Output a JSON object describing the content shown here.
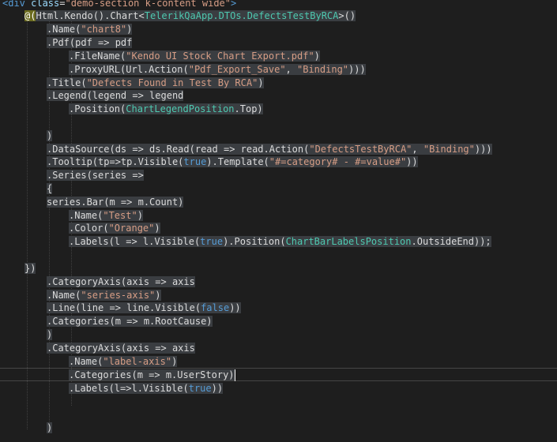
{
  "editor": {
    "lines": [
      {
        "indent": 0,
        "segments": [
          {
            "c": "t-tag",
            "t": "<div "
          },
          {
            "c": "t-attr",
            "t": "class"
          },
          {
            "c": "t-plain",
            "t": "="
          },
          {
            "c": "t-str",
            "t": "\"demo-section k-content wide\""
          },
          {
            "c": "t-tag",
            "t": ">"
          }
        ]
      },
      {
        "indent": 1,
        "segments": [
          {
            "c": "t-razor",
            "t": "@("
          },
          {
            "c": "t-plain",
            "t": "Html.Kendo().Chart<"
          },
          {
            "c": "t-type",
            "t": "TelerikQaApp.DTOs.DefectsTestByRCA"
          },
          {
            "c": "t-plain",
            "t": ">()"
          }
        ]
      },
      {
        "indent": 2,
        "segments": [
          {
            "c": "t-plain",
            "t": ".Name("
          },
          {
            "c": "t-str",
            "t": "\"chart8\""
          },
          {
            "c": "t-plain",
            "t": ")"
          }
        ]
      },
      {
        "indent": 2,
        "segments": [
          {
            "c": "t-plain",
            "t": ".Pdf(pdf => pdf"
          }
        ]
      },
      {
        "indent": 3,
        "segments": [
          {
            "c": "t-plain",
            "t": ".FileName("
          },
          {
            "c": "t-str",
            "t": "\"Kendo UI Stock Chart Export.pdf\""
          },
          {
            "c": "t-plain",
            "t": ")"
          }
        ]
      },
      {
        "indent": 3,
        "segments": [
          {
            "c": "t-plain",
            "t": ".ProxyURL(Url.Action("
          },
          {
            "c": "t-str",
            "t": "\"Pdf_Export_Save\""
          },
          {
            "c": "t-plain",
            "t": ", "
          },
          {
            "c": "t-str",
            "t": "\"Binding\""
          },
          {
            "c": "t-plain",
            "t": ")))"
          }
        ]
      },
      {
        "indent": 2,
        "segments": [
          {
            "c": "t-plain",
            "t": ".Title("
          },
          {
            "c": "t-str",
            "t": "\"Defects Found in Test By RCA\""
          },
          {
            "c": "t-plain",
            "t": ")"
          }
        ]
      },
      {
        "indent": 2,
        "segments": [
          {
            "c": "t-plain",
            "t": ".Legend(legend => legend"
          }
        ]
      },
      {
        "indent": 3,
        "segments": [
          {
            "c": "t-plain",
            "t": ".Position("
          },
          {
            "c": "t-type",
            "t": "ChartLegendPosition"
          },
          {
            "c": "t-plain",
            "t": ".Top)"
          }
        ]
      },
      {
        "indent": 0,
        "segments": []
      },
      {
        "indent": 2,
        "segments": [
          {
            "c": "t-plain",
            "t": ")"
          }
        ]
      },
      {
        "indent": 2,
        "segments": [
          {
            "c": "t-plain",
            "t": ".DataSource(ds => ds.Read(read => read.Action("
          },
          {
            "c": "t-str",
            "t": "\"DefectsTestByRCA\""
          },
          {
            "c": "t-plain",
            "t": ", "
          },
          {
            "c": "t-str",
            "t": "\"Binding\""
          },
          {
            "c": "t-plain",
            "t": ")))"
          }
        ]
      },
      {
        "indent": 2,
        "segments": [
          {
            "c": "t-plain",
            "t": ".Tooltip(tp=>tp.Visible("
          },
          {
            "c": "t-kw",
            "t": "true"
          },
          {
            "c": "t-plain",
            "t": ").Template("
          },
          {
            "c": "t-str",
            "t": "\"#=category# - #=value#\""
          },
          {
            "c": "t-plain",
            "t": "))"
          }
        ]
      },
      {
        "indent": 2,
        "segments": [
          {
            "c": "t-plain",
            "t": ".Series(series =>"
          }
        ]
      },
      {
        "indent": 2,
        "segments": [
          {
            "c": "t-plain",
            "t": "{"
          }
        ]
      },
      {
        "indent": 2,
        "segments": [
          {
            "c": "t-plain",
            "t": "series.Bar(m => m.Count)"
          }
        ]
      },
      {
        "indent": 3,
        "segments": [
          {
            "c": "t-plain",
            "t": ".Name("
          },
          {
            "c": "t-str",
            "t": "\"Test\""
          },
          {
            "c": "t-plain",
            "t": ")"
          }
        ]
      },
      {
        "indent": 3,
        "segments": [
          {
            "c": "t-plain",
            "t": ".Color("
          },
          {
            "c": "t-str",
            "t": "\"Orange\""
          },
          {
            "c": "t-plain",
            "t": ")"
          }
        ]
      },
      {
        "indent": 3,
        "segments": [
          {
            "c": "t-plain",
            "t": ".Labels(l => l.Visible("
          },
          {
            "c": "t-kw",
            "t": "true"
          },
          {
            "c": "t-plain",
            "t": ").Position("
          },
          {
            "c": "t-type",
            "t": "ChartBarLabelsPosition"
          },
          {
            "c": "t-plain",
            "t": ".OutsideEnd));"
          }
        ]
      },
      {
        "indent": 0,
        "segments": []
      },
      {
        "indent": 1,
        "segments": [
          {
            "c": "t-plain",
            "t": "})"
          }
        ]
      },
      {
        "indent": 2,
        "segments": [
          {
            "c": "t-plain",
            "t": ".CategoryAxis(axis => axis"
          }
        ]
      },
      {
        "indent": 2,
        "segments": [
          {
            "c": "t-plain",
            "t": ".Name("
          },
          {
            "c": "t-str",
            "t": "\"series-axis\""
          },
          {
            "c": "t-plain",
            "t": ")"
          }
        ]
      },
      {
        "indent": 2,
        "segments": [
          {
            "c": "t-plain",
            "t": ".Line(line => line.Visible("
          },
          {
            "c": "t-kw",
            "t": "false"
          },
          {
            "c": "t-plain",
            "t": "))"
          }
        ]
      },
      {
        "indent": 2,
        "segments": [
          {
            "c": "t-plain",
            "t": ".Categories(m => m.RootCause)"
          }
        ]
      },
      {
        "indent": 2,
        "segments": [
          {
            "c": "t-plain",
            "t": ")"
          }
        ]
      },
      {
        "indent": 2,
        "segments": [
          {
            "c": "t-plain",
            "t": ".CategoryAxis(axis => axis"
          }
        ]
      },
      {
        "indent": 3,
        "segments": [
          {
            "c": "t-plain",
            "t": ".Name("
          },
          {
            "c": "t-str",
            "t": "\"label-axis\""
          },
          {
            "c": "t-plain",
            "t": ")"
          }
        ]
      },
      {
        "indent": 3,
        "segments": [
          {
            "c": "t-plain",
            "t": ".Categories(m => m.UserStory)"
          }
        ]
      },
      {
        "indent": 3,
        "segments": [
          {
            "c": "t-plain",
            "t": ".Labels(l=>l.Visible("
          },
          {
            "c": "t-kw",
            "t": "true"
          },
          {
            "c": "t-plain",
            "t": "))"
          }
        ]
      },
      {
        "indent": 0,
        "segments": []
      },
      {
        "indent": 0,
        "segments": []
      },
      {
        "indent": 2,
        "segments": [
          {
            "c": "t-plain",
            "t": ")"
          }
        ]
      }
    ]
  }
}
